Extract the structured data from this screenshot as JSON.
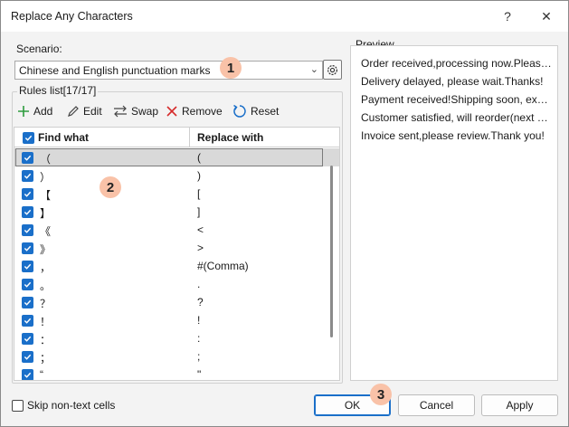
{
  "window": {
    "title": "Replace Any Characters",
    "help_label": "?",
    "close_label": "✕"
  },
  "scenario": {
    "label": "Scenario:",
    "selected": "Chinese and English punctuation marks"
  },
  "rules": {
    "label": "Rules list[17/17]",
    "toolbar": {
      "add": "Add",
      "edit": "Edit",
      "swap": "Swap",
      "remove": "Remove",
      "reset": "Reset"
    },
    "headers": {
      "find": "Find what",
      "replace": "Replace with"
    },
    "rows": [
      {
        "find": "（",
        "replace": "("
      },
      {
        "find": "）",
        "replace": ")"
      },
      {
        "find": "【",
        "replace": "["
      },
      {
        "find": "】",
        "replace": "]"
      },
      {
        "find": "《",
        "replace": "<"
      },
      {
        "find": "》",
        "replace": ">"
      },
      {
        "find": "，",
        "replace": "#(Comma)"
      },
      {
        "find": "。",
        "replace": "."
      },
      {
        "find": "？",
        "replace": "?"
      },
      {
        "find": "！",
        "replace": "!"
      },
      {
        "find": "：",
        "replace": ":"
      },
      {
        "find": "；",
        "replace": ";"
      },
      {
        "find": "“",
        "replace": "\""
      }
    ]
  },
  "preview": {
    "label": "Preview",
    "lines": [
      "Order received,processing now.Please wait.",
      "Delivery delayed, please wait.Thanks!",
      "Payment received!Shipping soon, expect soon.",
      "Customer satisfied, will reorder(next month).",
      "Invoice sent,please review.Thank you!"
    ]
  },
  "footer": {
    "skip_label": "Skip non-text cells",
    "ok": "OK",
    "cancel": "Cancel",
    "apply": "Apply"
  },
  "badges": {
    "one": "1",
    "two": "2",
    "three": "3"
  },
  "colors": {
    "accent": "#1a6fc9",
    "badge": "#f9c2a8"
  }
}
